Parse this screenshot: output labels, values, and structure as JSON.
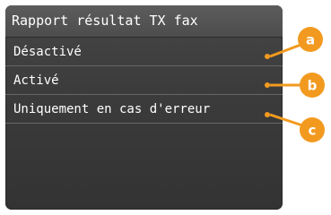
{
  "screen": {
    "title": "Rapport résultat TX fax"
  },
  "menu": {
    "items": [
      {
        "label": "Désactivé",
        "callout": "a"
      },
      {
        "label": "Activé",
        "callout": "b"
      },
      {
        "label": "Uniquement en cas d'erreur",
        "callout": "c"
      }
    ]
  },
  "colors": {
    "callout_orange": "#f29a1f",
    "screen_background": "#3b3b3b",
    "title_bar": "#555555"
  }
}
